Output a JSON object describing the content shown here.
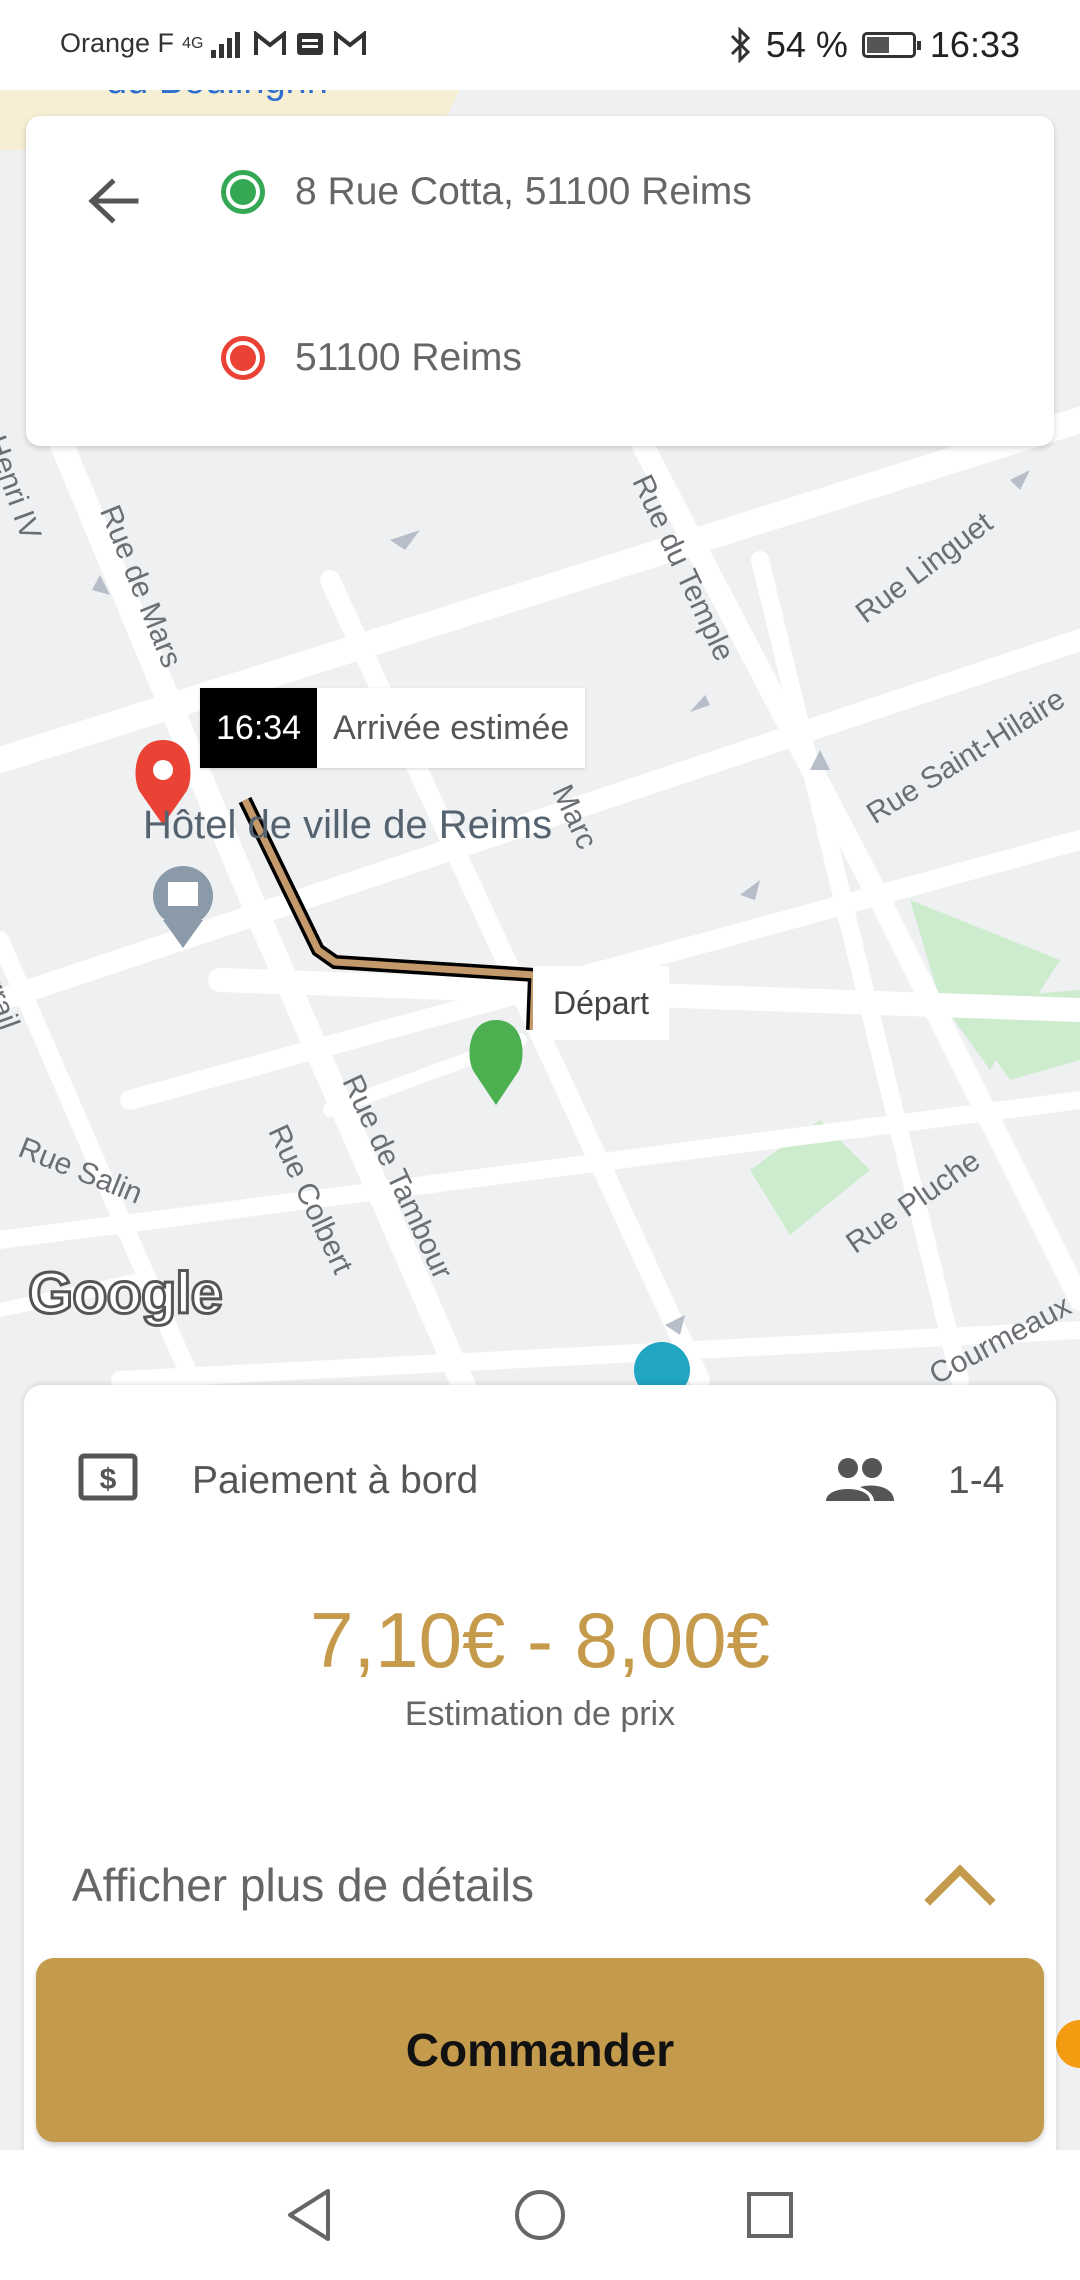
{
  "status_bar": {
    "carrier": "Orange F",
    "network": "4G",
    "battery_percent": "54 %",
    "battery_level": 0.54,
    "time": "16:33"
  },
  "address_card": {
    "back_icon": "arrow-left-icon",
    "origin": "8 Rue Cotta, 51100 Reims",
    "destination": "51100 Reims",
    "origin_color": "#34a853",
    "destination_color": "#ea4335"
  },
  "map": {
    "eta_time": "16:34",
    "eta_label": "Arrivée estimée",
    "depart_label": "Départ",
    "poi_name": "Hôtel de ville de Reims",
    "top_place": "du Boulingrin",
    "streets": [
      "Henri IV",
      "Rue de Mars",
      "Rue du Temple",
      "Rue Linguet",
      "Rue Saint-Hilaire",
      "Sarrail",
      "Rue Colbert",
      "Rue de Tambour",
      "Rue Pluche",
      "Rue Salin",
      "Courmeaux",
      "Marc"
    ],
    "logo": "Google"
  },
  "sheet": {
    "payment_label": "Paiement à bord",
    "seats": "1-4",
    "price": "7,10€ - 8,00€",
    "price_caption": "Estimation de prix",
    "details_label": "Afficher plus de détails",
    "accent_color": "#c49a4c"
  },
  "order_button": {
    "label": "Commander"
  },
  "navbar": {
    "back": "triangle-back-icon",
    "home": "circle-home-icon",
    "recents": "square-recents-icon"
  }
}
